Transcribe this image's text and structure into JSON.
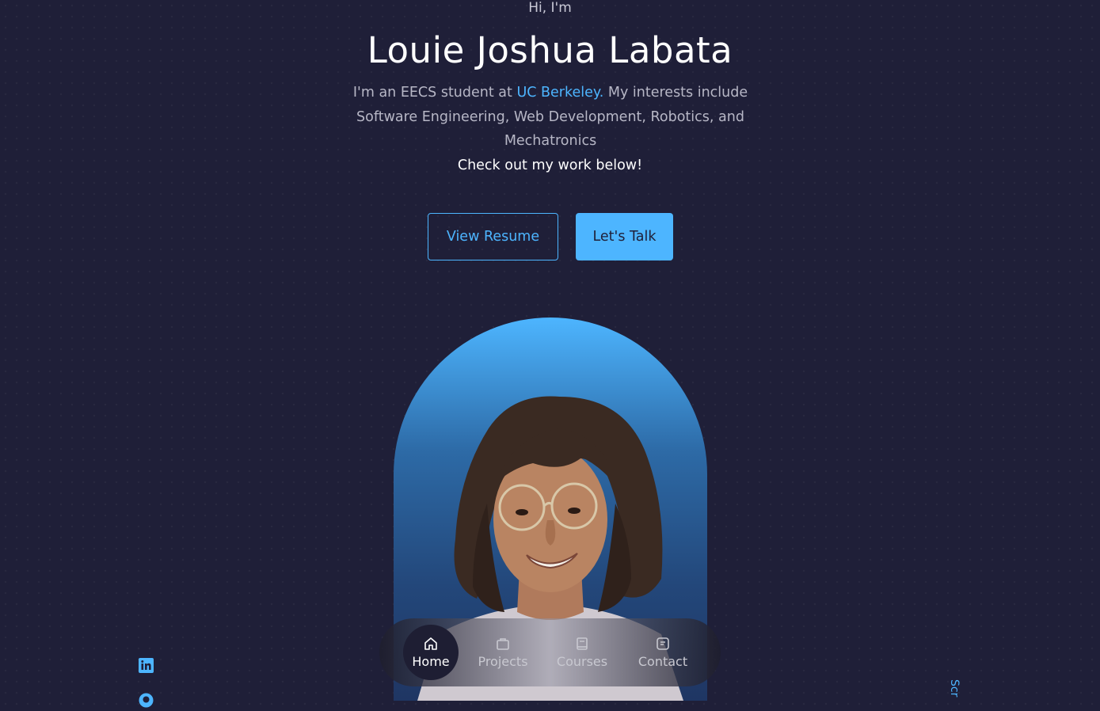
{
  "hero": {
    "greeting": "Hi, I'm",
    "name": "Louie Joshua Labata",
    "bio_prefix": "I'm an EECS student at ",
    "bio_highlight": "UC Berkeley.",
    "bio_suffix": " My interests include Software Engineering, Web Development, Robotics, and Mechatronics",
    "cta_line": "Check out my work below!"
  },
  "buttons": {
    "resume_label": "View Resume",
    "talk_label": "Let's Talk"
  },
  "nav": {
    "items": [
      {
        "label": "Home",
        "icon": "home-icon"
      },
      {
        "label": "Projects",
        "icon": "briefcase-icon"
      },
      {
        "label": "Courses",
        "icon": "book-icon"
      },
      {
        "label": "Contact",
        "icon": "message-icon"
      }
    ],
    "active": "Home"
  },
  "socials": [
    {
      "icon": "linkedin-icon"
    },
    {
      "icon": "github-icon"
    }
  ],
  "scroll_label": "Scr",
  "colors": {
    "background": "#1f1f38",
    "accent": "#4db5ff",
    "text_muted": "#b7b7c6"
  }
}
